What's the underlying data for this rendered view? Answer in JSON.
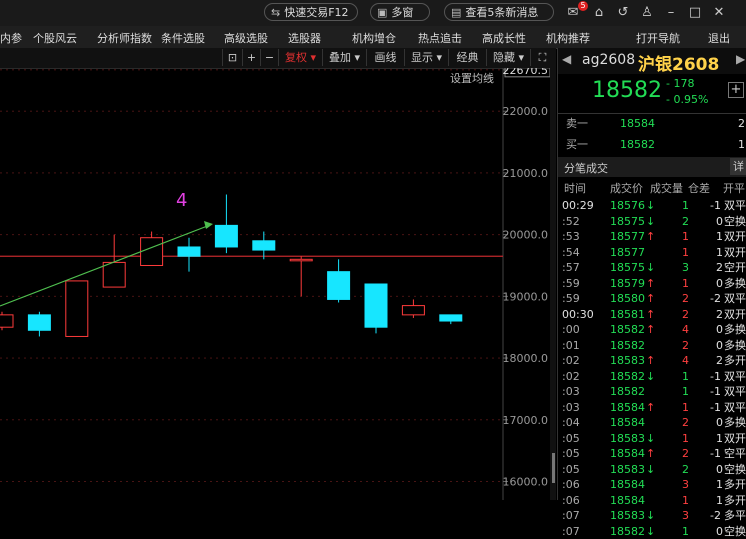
{
  "topbar": {
    "quick_trade": "快速交易F12",
    "multi_window": "多窗口",
    "messages": "查看5条新消息",
    "badge": "5"
  },
  "menu": {
    "items": [
      "内参",
      "个股风云",
      "分析师指数",
      "条件选股",
      "高级选股",
      "选股器",
      "机构增仓",
      "热点追击",
      "高成长性",
      "机构推荐",
      "打开导航",
      "退出"
    ]
  },
  "toolbar": {
    "fuquan": "复权",
    "overlay": "叠加",
    "draw": "画线",
    "display": "显示",
    "classic": "经典",
    "hide": "隐藏",
    "ma_setting": "设置均线"
  },
  "chart_data": {
    "type": "candlestick",
    "ylim": [
      15700,
      22700
    ],
    "yticks": [
      "22670.5",
      "22000.0",
      "21000.0",
      "20000.0",
      "19000.0",
      "18000.0",
      "17000.0",
      "16000.0"
    ],
    "hline": 19650,
    "annotation": "4",
    "candles": [
      {
        "open": 18700,
        "close": 18500,
        "high": 18750,
        "low": 18450,
        "color": "red"
      },
      {
        "open": 18700,
        "close": 18450,
        "high": 18750,
        "low": 18350,
        "color": "cyan"
      },
      {
        "open": 18350,
        "close": 19250,
        "high": 19250,
        "low": 18350,
        "color": "red"
      },
      {
        "open": 19150,
        "close": 19550,
        "high": 20000,
        "low": 19150,
        "color": "red"
      },
      {
        "open": 19500,
        "close": 19950,
        "high": 20050,
        "low": 19500,
        "color": "red"
      },
      {
        "open": 19650,
        "close": 19800,
        "high": 19950,
        "low": 19400,
        "color": "cyan"
      },
      {
        "open": 19800,
        "close": 20150,
        "high": 20650,
        "low": 19700,
        "color": "cyan"
      },
      {
        "open": 19900,
        "close": 19750,
        "high": 20050,
        "low": 19600,
        "color": "cyan"
      },
      {
        "open": 19600,
        "close": 19600,
        "high": 19650,
        "low": 19000,
        "color": "red"
      },
      {
        "open": 19400,
        "close": 18950,
        "high": 19600,
        "low": 18900,
        "color": "cyan"
      },
      {
        "open": 19200,
        "close": 18500,
        "high": 19200,
        "low": 18400,
        "color": "cyan"
      },
      {
        "open": 18700,
        "close": 18850,
        "high": 18950,
        "low": 18650,
        "color": "red"
      },
      {
        "open": 18700,
        "close": 18600,
        "high": 18700,
        "low": 18550,
        "color": "cyan"
      }
    ]
  },
  "quote": {
    "code": "ag2608",
    "name": "沪银2608",
    "price": "18582",
    "change": "- 178",
    "change_pct": "- 0.95%",
    "ask_label": "卖一",
    "ask_price": "18584",
    "ask_vol": "2",
    "bid_label": "买一",
    "bid_price": "18582",
    "bid_vol": "1",
    "ticks_title": "分笔成交",
    "ticks_detail": "详",
    "headers": [
      "时间",
      "成交价",
      "成交量",
      "仓差",
      "开平"
    ]
  },
  "ticks": [
    {
      "time": "00:29",
      "price": "18576",
      "dir": "down",
      "vol": "1",
      "oi": "-1",
      "type": "双平"
    },
    {
      "time": ":52",
      "price": "18575",
      "dir": "down",
      "vol": "2",
      "oi": "0",
      "type": "空换"
    },
    {
      "time": ":53",
      "price": "18577",
      "dir": "up",
      "vol": "1",
      "oi": "1",
      "type": "双开"
    },
    {
      "time": ":54",
      "price": "18577",
      "dir": "",
      "vol": "1",
      "oi": "1",
      "type": "双开"
    },
    {
      "time": ":57",
      "price": "18575",
      "dir": "down",
      "vol": "3",
      "oi": "2",
      "type": "空开"
    },
    {
      "time": ":59",
      "price": "18579",
      "dir": "up",
      "vol": "1",
      "oi": "0",
      "type": "多换"
    },
    {
      "time": ":59",
      "price": "18580",
      "dir": "up",
      "vol": "2",
      "oi": "-2",
      "type": "双平"
    },
    {
      "time": "00:30",
      "price": "18581",
      "dir": "up",
      "vol": "2",
      "oi": "2",
      "type": "双开"
    },
    {
      "time": ":00",
      "price": "18582",
      "dir": "up",
      "vol": "4",
      "oi": "0",
      "type": "多换"
    },
    {
      "time": ":01",
      "price": "18582",
      "dir": "",
      "vol": "2",
      "oi": "0",
      "type": "多换"
    },
    {
      "time": ":02",
      "price": "18583",
      "dir": "up",
      "vol": "4",
      "oi": "2",
      "type": "多开"
    },
    {
      "time": ":02",
      "price": "18582",
      "dir": "down",
      "vol": "1",
      "oi": "-1",
      "type": "双平"
    },
    {
      "time": ":03",
      "price": "18582",
      "dir": "",
      "vol": "1",
      "oi": "-1",
      "type": "双平"
    },
    {
      "time": ":03",
      "price": "18584",
      "dir": "up",
      "vol": "1",
      "oi": "-1",
      "type": "双平"
    },
    {
      "time": ":04",
      "price": "18584",
      "dir": "",
      "vol": "2",
      "oi": "0",
      "type": "多换"
    },
    {
      "time": ":05",
      "price": "18583",
      "dir": "down",
      "vol": "1",
      "oi": "1",
      "type": "双开"
    },
    {
      "time": ":05",
      "price": "18584",
      "dir": "up",
      "vol": "2",
      "oi": "-1",
      "type": "空平"
    },
    {
      "time": ":05",
      "price": "18583",
      "dir": "down",
      "vol": "2",
      "oi": "0",
      "type": "空换"
    },
    {
      "time": ":06",
      "price": "18584",
      "dir": "",
      "vol": "3",
      "oi": "1",
      "type": "多开"
    },
    {
      "time": ":06",
      "price": "18584",
      "dir": "",
      "vol": "1",
      "oi": "1",
      "type": "多开"
    },
    {
      "time": ":07",
      "price": "18583",
      "dir": "down",
      "vol": "3",
      "oi": "-2",
      "type": "多平"
    },
    {
      "time": ":07",
      "price": "18582",
      "dir": "down",
      "vol": "1",
      "oi": "0",
      "type": "空换"
    }
  ],
  "colors": {
    "up": "#ff4040",
    "down": "#22dd55",
    "cyan": "#17e6ff",
    "hline": "#c0282c",
    "trend": "#4fbf4f",
    "annotation": "#e040e0"
  }
}
